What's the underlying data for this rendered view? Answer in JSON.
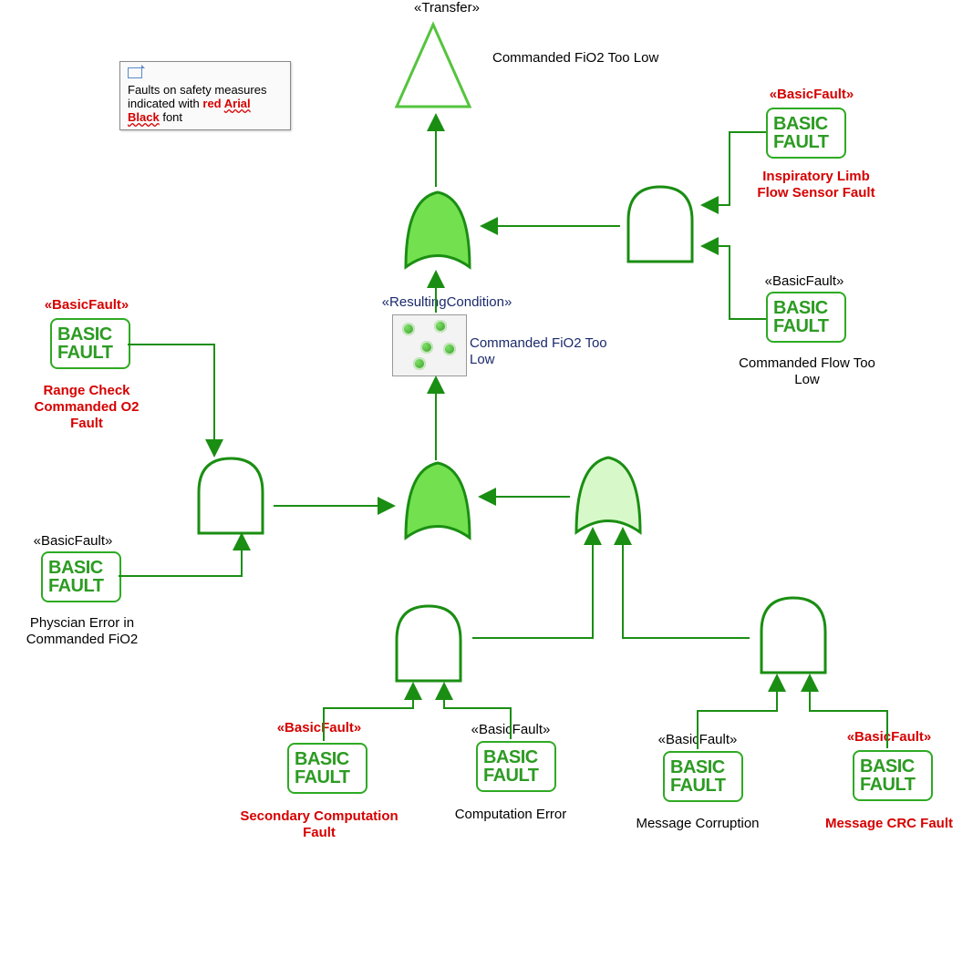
{
  "note": {
    "text_prefix": "Faults on safety measures indicated with ",
    "text_red1": "red ",
    "text_red2": "Arial Black",
    "text_red3": " ",
    "text_suffix": "font"
  },
  "stereotypes": {
    "transfer": "«Transfer»",
    "resulting": "«ResultingCondition»",
    "basic": "«BasicFault»"
  },
  "labels": {
    "top_event": "Commanded FiO2 Too Low",
    "cond": "Commanded FiO2 Too Low",
    "insp": "Inspiratory Limb Flow Sensor Fault",
    "flow_low": "Commanded Flow Too Low",
    "range_check": "Range Check Commanded O2 Fault",
    "phys_err": "Physcian Error in Commanded FiO2",
    "sec_comp": "Secondary Computation Fault",
    "comp_err": "Computation Error",
    "msg_corr": "Message Corruption",
    "msg_crc": "Message CRC Fault"
  },
  "basic_text": {
    "l1": "BASIC",
    "l2": "FAULT"
  }
}
